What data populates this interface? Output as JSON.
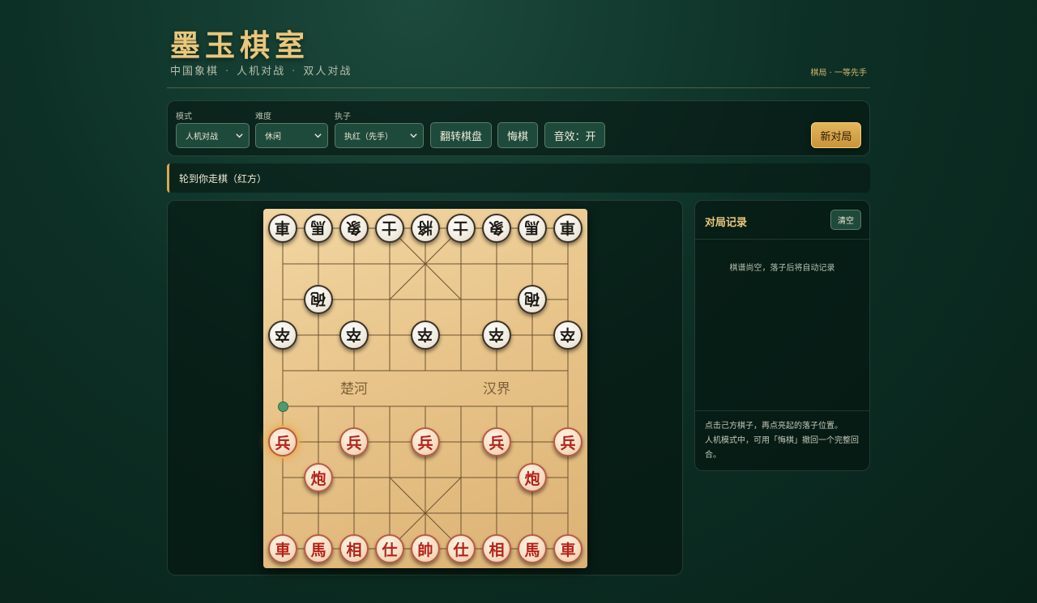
{
  "header": {
    "title": "墨玉棋室",
    "subtitle": [
      "中国象棋",
      "人机对战",
      "双人对战"
    ],
    "subtitle_sep": "·",
    "right_note": "棋局 · 一等先手"
  },
  "controls": {
    "mode": {
      "label": "模式",
      "value": "人机对战"
    },
    "difficulty": {
      "label": "难度",
      "value": "休闲"
    },
    "side": {
      "label": "执子",
      "value": "执红（先手）"
    },
    "flip_label": "翻转棋盘",
    "undo_label": "悔棋",
    "sound_label": "音效：开",
    "new_game_label": "新对局"
  },
  "status": {
    "text": "轮到你走棋（红方）"
  },
  "board": {
    "river_left": "楚河",
    "river_right": "汉界",
    "hint_point": {
      "col": 0,
      "row": 5
    }
  },
  "pieces": {
    "black_back": [
      "車",
      "馬",
      "象",
      "士",
      "將",
      "士",
      "象",
      "馬",
      "車"
    ],
    "black_cannons": [
      "砲",
      "砲"
    ],
    "black_soldiers": [
      "卒",
      "卒",
      "卒",
      "卒",
      "卒"
    ],
    "red_soldiers": [
      "兵",
      "兵",
      "兵",
      "兵",
      "兵"
    ],
    "red_cannons": [
      "炮",
      "炮"
    ],
    "red_back": [
      "車",
      "馬",
      "相",
      "仕",
      "帥",
      "仕",
      "相",
      "馬",
      "車"
    ]
  },
  "record": {
    "title": "对局记录",
    "clear_label": "清空",
    "empty_text": "棋谱尚空，落子后将自动记录",
    "help": [
      "点击己方棋子，再点亮起的落子位置。",
      "人机模式中，可用「悔棋」撤回一个完整回合。"
    ]
  },
  "colors": {
    "accent_gold": "#e9c77c",
    "background": "#0d3026",
    "board_wood": "#e8c48a",
    "red_piece": "#b52218",
    "black_piece": "#1c1812",
    "hint_green": "#4f9a6c"
  }
}
